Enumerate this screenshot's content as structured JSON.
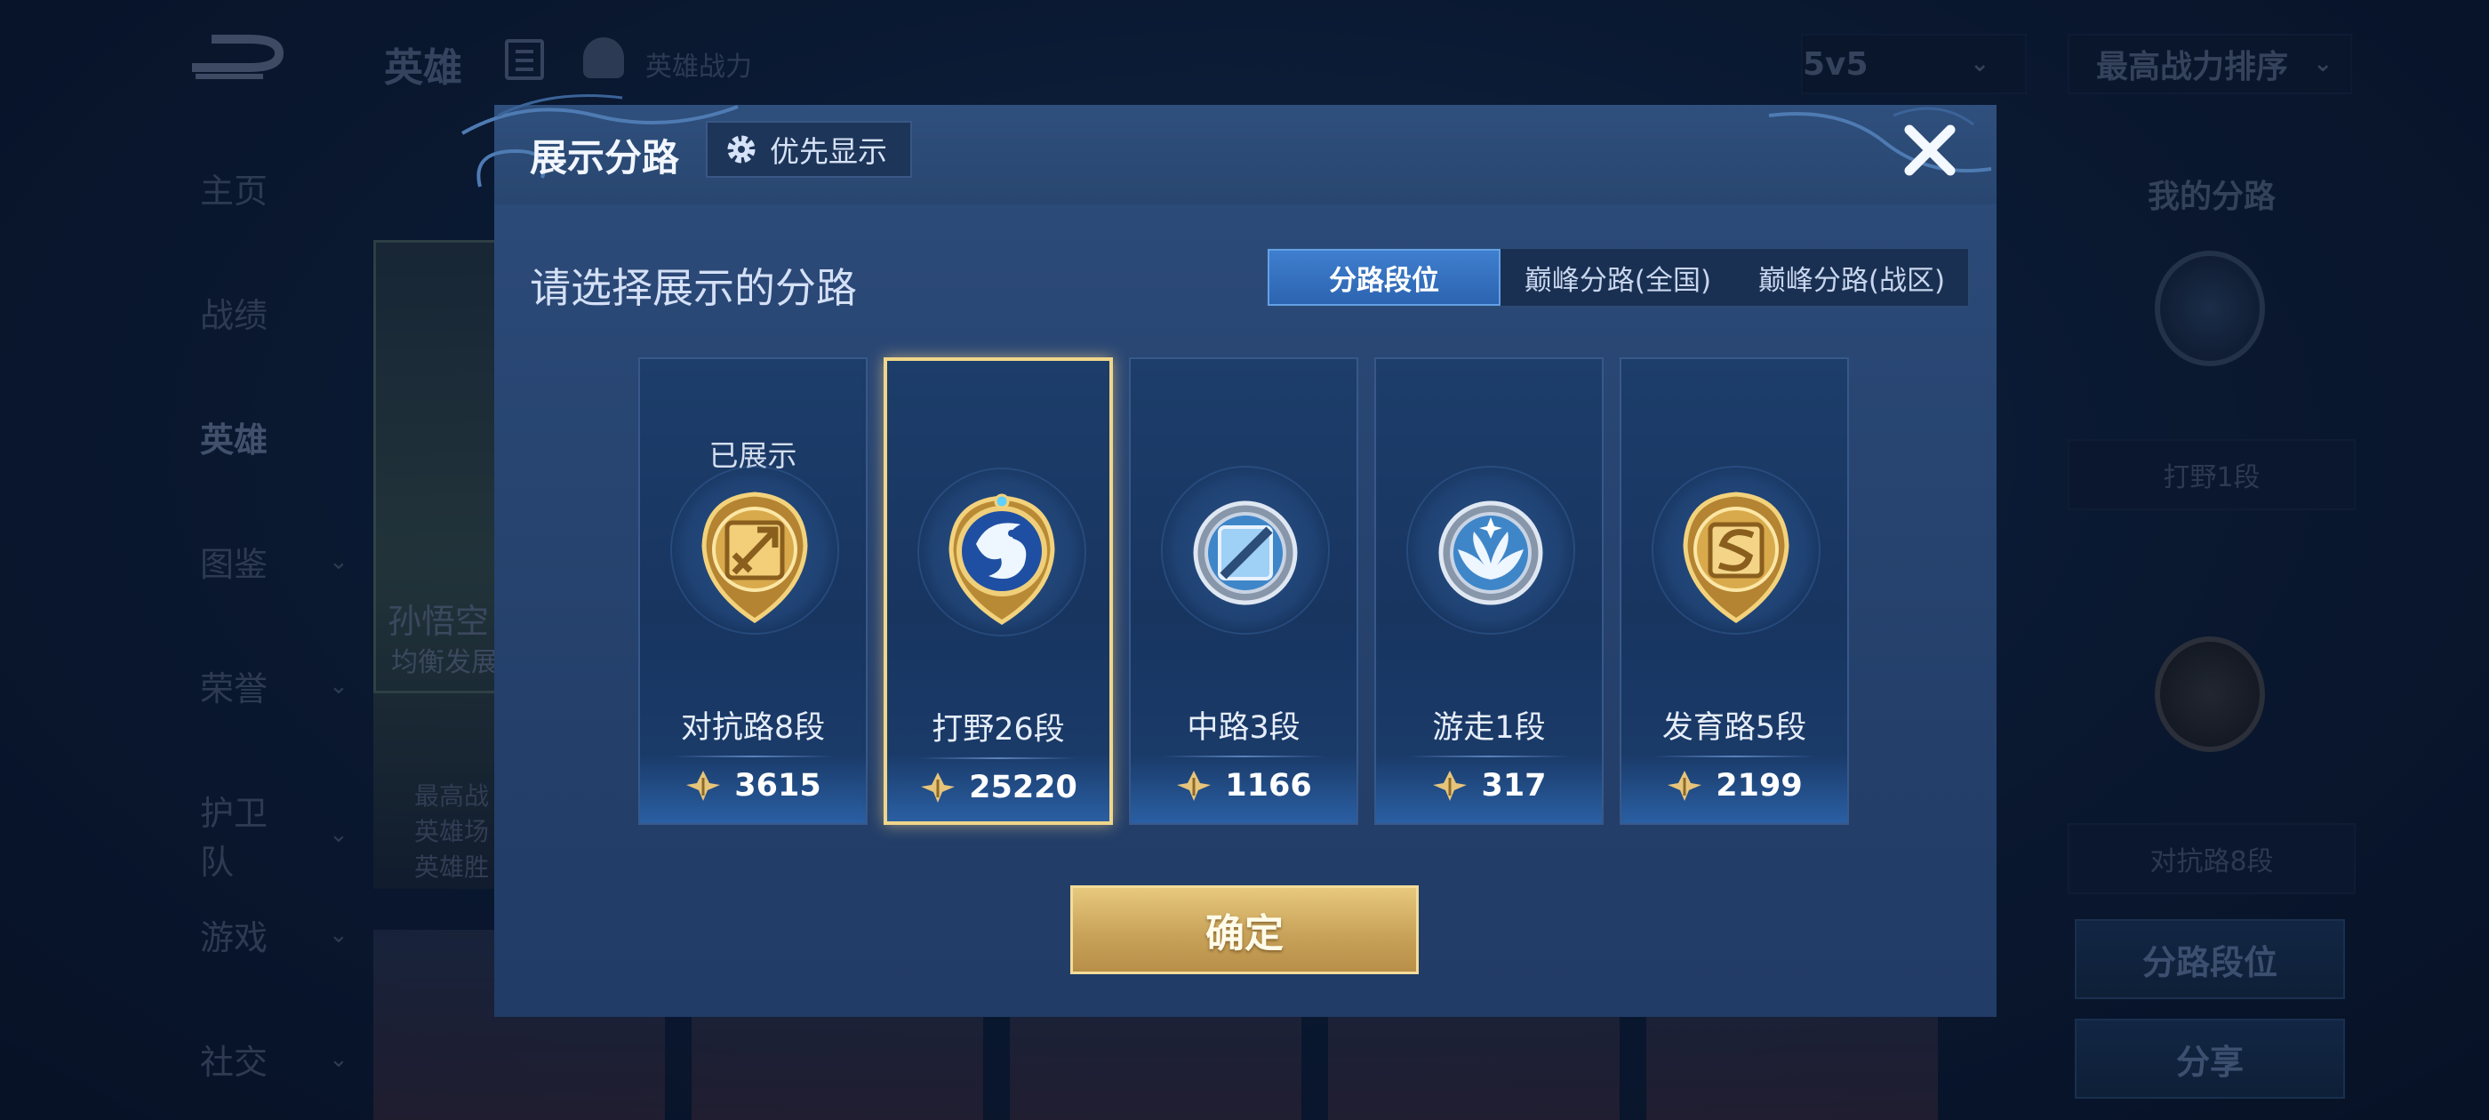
{
  "header": {
    "title": "英雄",
    "power_label": "英雄战力",
    "mode_select": "5v5",
    "sort_select": "最高战力排序"
  },
  "sidebar": {
    "items": [
      {
        "label": "主页"
      },
      {
        "label": "战绩"
      },
      {
        "label": "英雄"
      },
      {
        "label": "图鉴"
      },
      {
        "label": "荣誉"
      },
      {
        "label": "护卫队"
      },
      {
        "label": "游戏"
      },
      {
        "label": "社交"
      }
    ]
  },
  "hero_panel": {
    "name": "孙悟空",
    "subtitle": "均衡发展",
    "info": [
      "最高战",
      "英雄场",
      "英雄胜"
    ]
  },
  "right_panel": {
    "title": "我的分路",
    "lane1": "打野1段",
    "lane2": "对抗路8段",
    "lane_rank_button": "分路段位",
    "share_button": "分享"
  },
  "modal": {
    "title": "展示分路",
    "priority_button": "优先显示",
    "prompt": "请选择展示的分路",
    "tabs": [
      "分路段位",
      "巅峰分路(全国)",
      "巅峰分路(战区)"
    ],
    "active_tab": "分路段位",
    "shown_label": "已展示",
    "confirm": "确定",
    "lanes": [
      {
        "name": "对抗路8段",
        "score": "3615",
        "shown": true,
        "badge": "gold-sword-badge-icon"
      },
      {
        "name": "打野26段",
        "score": "25220",
        "selected": true,
        "badge": "dragon-jungle-badge-icon"
      },
      {
        "name": "中路3段",
        "score": "1166",
        "badge": "silver-mid-badge-icon"
      },
      {
        "name": "游走1段",
        "score": "317",
        "badge": "wing-roam-badge-icon"
      },
      {
        "name": "发育路5段",
        "score": "2199",
        "badge": "gold-adc-badge-icon"
      }
    ]
  },
  "colors": {
    "accent_blue": "#2c64b0",
    "gold": "#c9a35a",
    "selected_border": "#f0d68a",
    "background": "#0f2342"
  }
}
